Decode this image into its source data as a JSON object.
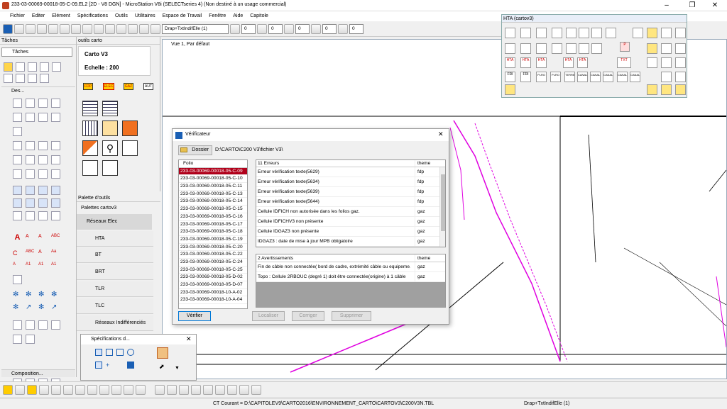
{
  "window": {
    "title": "233-03-00069-00018-05-C-09.EL2 [2D - V8 DGN] - MicroStation V8i (SELECTseries 4) (Non destiné à un usage commercial)"
  },
  "menu": [
    "Fichier",
    "Editer",
    "Elément",
    "Spécifications",
    "Outils",
    "Utilitaires",
    "Espace de Travail",
    "Fenêtre",
    "Aide",
    "Capitole"
  ],
  "toolbar": {
    "level_combo": "Drap+TxtIndifElle (1)",
    "weight1": "0",
    "weight2": "0",
    "weight3": "0",
    "weight4": "0",
    "weight5": "0",
    "weight6": "0"
  },
  "taches": {
    "title": "Tâches",
    "dropdown": "Tâches",
    "des_label": "Des...",
    "composition_label": "Composition..."
  },
  "outils": {
    "title": "outils carto",
    "carto": "Carto V3",
    "echelle": "Echelle : 200",
    "btn_fdp": "FDP",
    "btn_elec": "ELEC",
    "btn_gaz": "GAZ",
    "btn_aut": "AUT"
  },
  "palette": {
    "title": "Palette d'outils",
    "sub": "Palettes cartov3",
    "group": "Réseaux Elec",
    "items": [
      "HTA",
      "BT",
      "BRT",
      "TLR",
      "TLC",
      "Réseaux Indifférenciés"
    ]
  },
  "view": {
    "title": "Vue 1, Par défaut"
  },
  "hta": {
    "title": "HTA (cartov3)",
    "txt_label": "TXT",
    "labels": [
      "HTA",
      "HTA",
      "HTA",
      "HTA",
      "HTA"
    ],
    "row3": [
      "FRI",
      "FRI",
      "PLRO",
      "PLRO",
      "TERRE",
      "CANAL",
      "CANAL",
      "CANAL",
      "CANAL",
      "CANAL"
    ]
  },
  "verif": {
    "title": "Vérificateur",
    "dossier_btn": "Dossier",
    "path": "D:\\CARTO\\C200 V3\\fichier V3\\",
    "folio_header": "Folio",
    "folios": [
      "233-03-00069-00018-05-C-09",
      "233-03-00069-00018-05-C-10",
      "233-03-00069-00018-05-C-11",
      "233-03-00069-00018-05-C-13",
      "233-03-00069-00018-05-C-14",
      "233-03-00069-00018-05-C-15",
      "233-03-00069-00018-05-C-16",
      "233-03-00069-00018-05-C-17",
      "233-03-00069-00018-05-C-18",
      "233-03-00069-00018-05-C-19",
      "233-03-00069-00018-05-C-20",
      "233-03-00069-00018-05-C-22",
      "233-03-00069-00018-05-C-24",
      "233-03-00069-00018-05-C-25",
      "233-03-00069-00018-05-D-02",
      "233-03-00069-00018-05-D-07",
      "233-03-00069-00018-10-A-02",
      "233-03-00069-00018-10-A-04"
    ],
    "errors_header": "11 Erreurs",
    "theme_header": "theme",
    "errors": [
      {
        "msg": "Erreur vérification texte(5629)",
        "theme": "fdp"
      },
      {
        "msg": "Erreur vérification texte(5634)",
        "theme": "fdp"
      },
      {
        "msg": "Erreur vérification texte(5639)",
        "theme": "fdp"
      },
      {
        "msg": "Erreur vérification texte(5644)",
        "theme": "fdp"
      },
      {
        "msg": "Cellule IDFICH non autorisée dans les folios gaz.",
        "theme": "gaz"
      },
      {
        "msg": "Cellule IDFICHV3 non présente",
        "theme": "gaz"
      },
      {
        "msg": "Cellule IDGAZ3 non présente",
        "theme": "gaz"
      },
      {
        "msg": "IDGAZ3 : date de mise à jour MPB obligatoire",
        "theme": "gaz"
      }
    ],
    "warn_header": "2 Avertissements",
    "warn_theme_header": "theme",
    "warnings": [
      {
        "msg": "Fin de câble non connectée( bord de cadre, extrémité câble ou equipeme...",
        "theme": "gaz"
      },
      {
        "msg": "Topo : Cellule 2RBOUC (degré 1) doit être connectée(origine) à 1 câble",
        "theme": "gaz"
      }
    ],
    "btn_verifier": "Vérifier",
    "btn_localiser": "Localiser",
    "btn_corriger": "Corriger",
    "btn_supprimer": "Supprimer"
  },
  "spec": {
    "title": "Spécifications d..."
  },
  "status": {
    "text": "CT Courant = D:\\CAPITOLEV9\\CARTO2016\\ENVIRONNEMENT_CARTO\\CARTOV3\\C200V3N.TBL",
    "level": "Drap+TxtIndifElle (1)"
  },
  "colors": {
    "selected": "#b0001a",
    "magenta": "#e000e0",
    "accent": "#0078d7"
  }
}
